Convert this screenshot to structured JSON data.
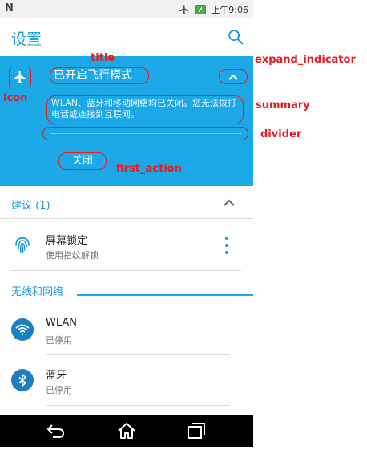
{
  "statusbar": {
    "carrier_glyph": "N",
    "time": "上午9:06",
    "icons": [
      "airplane-icon",
      "battery-charging-icon"
    ]
  },
  "appbar": {
    "title": "设置",
    "search_icon": "search-icon"
  },
  "card": {
    "title": "已开启飞行模式",
    "summary": "WLAN、蓝牙和移动网络均已关闭。您无法拨打电话或连接到互联网。",
    "action_label": "关闭",
    "icon": "airplane-icon",
    "expand_icon": "chevron-up-icon",
    "color": "#1ba8e6"
  },
  "annotations": {
    "title": "title",
    "expand_indicator": "expand_indicator",
    "icon": "icon",
    "summary": "summary",
    "divider": "divider",
    "first_action": "first_action",
    "color": "#e51c23"
  },
  "suggestions": {
    "header": "建议 (1)",
    "items": [
      {
        "title": "屏幕锁定",
        "subtitle": "使用指纹解锁",
        "icon": "fingerprint-icon"
      }
    ]
  },
  "wireless": {
    "header": "无线和网络",
    "items": [
      {
        "title": "WLAN",
        "subtitle": "已停用",
        "icon": "wifi-icon"
      },
      {
        "title": "蓝牙",
        "subtitle": "已停用",
        "icon": "bluetooth-icon"
      }
    ]
  },
  "navbar": {
    "buttons": [
      "back-icon",
      "home-icon",
      "recents-icon"
    ]
  },
  "colors": {
    "accent": "#1b9bd1",
    "card": "#1ba8e6",
    "annotation": "#e51c23"
  }
}
